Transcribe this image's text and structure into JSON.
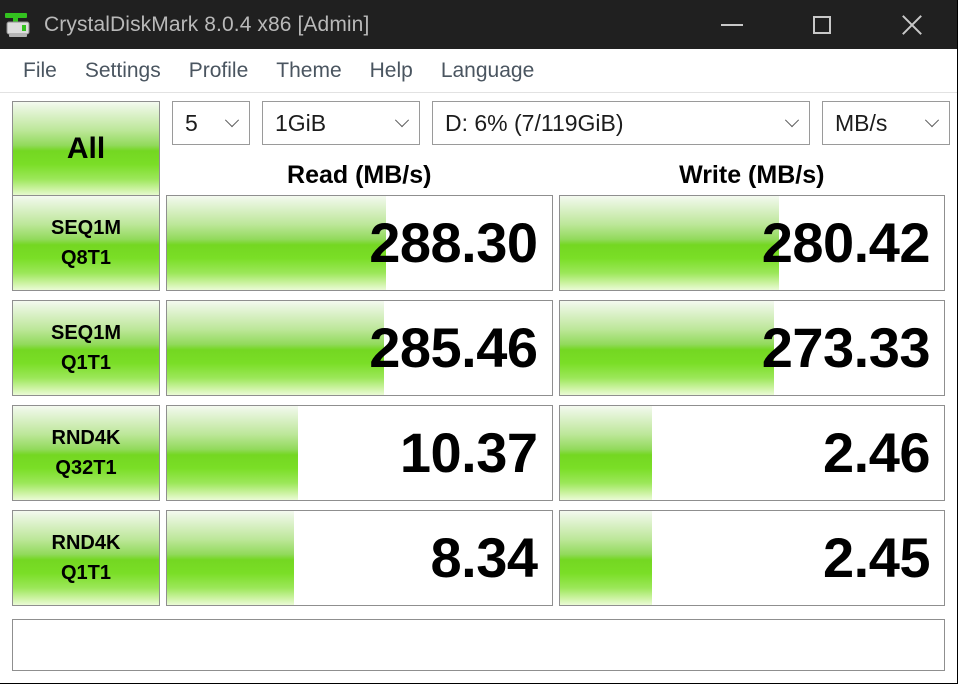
{
  "window": {
    "title": "CrystalDiskMark 8.0.4 x86 [Admin]",
    "icon": "disk-drive-icon",
    "controls": {
      "minimize": "minimize-icon",
      "maximize": "maximize-icon",
      "close": "close-icon"
    },
    "titlebar_bg": "#202020",
    "title_color": "#b9b9b9"
  },
  "menubar": {
    "items": [
      {
        "label": "File"
      },
      {
        "label": "Settings"
      },
      {
        "label": "Profile"
      },
      {
        "label": "Theme"
      },
      {
        "label": "Help"
      },
      {
        "label": "Language"
      }
    ]
  },
  "toolbar": {
    "all_button": "All",
    "test_count": "5",
    "test_size": "1GiB",
    "drive": "D: 6% (7/119GiB)",
    "unit": "MB/s",
    "chevron_icon": "chevron-down-icon"
  },
  "headers": {
    "read": "Read (MB/s)",
    "write": "Write (MB/s)"
  },
  "status": {
    "text": ""
  },
  "theme": {
    "accent_green": "#74d722",
    "bar_light": "#eafbd6",
    "border": "#8f8f8f"
  },
  "chart_data": {
    "type": "bar",
    "title": "CrystalDiskMark 8.0.4 benchmark results",
    "xlabel": "",
    "ylabel": "MB/s",
    "unit": "MB/s",
    "test_count": 5,
    "test_size": "1GiB",
    "drive": "D: 6% (7/119GiB)",
    "categories": [
      "SEQ1M Q8T1",
      "SEQ1M Q1T1",
      "RND4K Q32T1",
      "RND4K Q1T1"
    ],
    "series": [
      {
        "name": "Read (MB/s)",
        "values": [
          288.3,
          285.46,
          10.37,
          8.34
        ]
      },
      {
        "name": "Write (MB/s)",
        "values": [
          280.42,
          273.33,
          2.46,
          2.45
        ]
      }
    ],
    "legend_position": "top",
    "grid": false
  },
  "rows": [
    {
      "label_top": "SEQ1M",
      "label_bottom": "Q8T1",
      "read": {
        "value": "288.30",
        "bar_pct": 57
      },
      "write": {
        "value": "280.42",
        "bar_pct": 57
      }
    },
    {
      "label_top": "SEQ1M",
      "label_bottom": "Q1T1",
      "read": {
        "value": "285.46",
        "bar_pct": 56.5
      },
      "write": {
        "value": "273.33",
        "bar_pct": 55.8
      }
    },
    {
      "label_top": "RND4K",
      "label_bottom": "Q32T1",
      "read": {
        "value": "10.37",
        "bar_pct": 34
      },
      "write": {
        "value": "2.46",
        "bar_pct": 24
      }
    },
    {
      "label_top": "RND4K",
      "label_bottom": "Q1T1",
      "read": {
        "value": "8.34",
        "bar_pct": 33
      },
      "write": {
        "value": "2.45",
        "bar_pct": 24
      }
    }
  ]
}
